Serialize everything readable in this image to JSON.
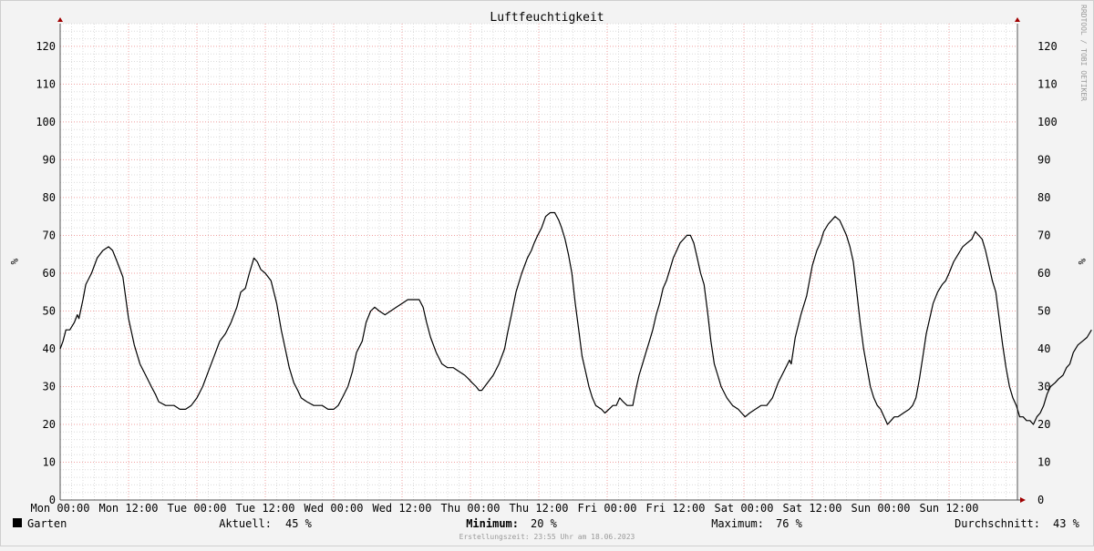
{
  "chart_data": {
    "type": "line",
    "title": "Luftfeuchtigkeit",
    "ylabel": "%",
    "ylim": [
      0,
      126
    ],
    "y_ticks": [
      0,
      10,
      20,
      30,
      40,
      50,
      60,
      70,
      80,
      90,
      100,
      110,
      120
    ],
    "x_range_hours": [
      0,
      168
    ],
    "x_ticks": [
      {
        "h": 0,
        "label": "Mon 00:00"
      },
      {
        "h": 12,
        "label": "Mon 12:00"
      },
      {
        "h": 24,
        "label": "Tue 00:00"
      },
      {
        "h": 36,
        "label": "Tue 12:00"
      },
      {
        "h": 48,
        "label": "Wed 00:00"
      },
      {
        "h": 60,
        "label": "Wed 12:00"
      },
      {
        "h": 72,
        "label": "Thu 00:00"
      },
      {
        "h": 84,
        "label": "Thu 12:00"
      },
      {
        "h": 96,
        "label": "Fri 00:00"
      },
      {
        "h": 108,
        "label": "Fri 12:00"
      },
      {
        "h": 120,
        "label": "Sat 00:00"
      },
      {
        "h": 132,
        "label": "Sat 12:00"
      },
      {
        "h": 144,
        "label": "Sun 00:00"
      },
      {
        "h": 156,
        "label": "Sun 12:00"
      }
    ],
    "grid": true,
    "series": [
      {
        "name": "Garten",
        "color": "#000000",
        "points": [
          [
            0,
            40
          ],
          [
            0.5,
            42
          ],
          [
            1,
            45
          ],
          [
            1.7,
            45
          ],
          [
            2.5,
            47
          ],
          [
            3,
            49
          ],
          [
            3.3,
            48
          ],
          [
            4,
            53
          ],
          [
            4.5,
            57
          ],
          [
            5.5,
            60
          ],
          [
            6.5,
            64
          ],
          [
            7.5,
            66
          ],
          [
            8.5,
            67
          ],
          [
            9.2,
            66
          ],
          [
            10,
            63
          ],
          [
            11,
            59
          ],
          [
            12,
            48
          ],
          [
            13,
            41
          ],
          [
            14,
            36
          ],
          [
            15,
            33
          ],
          [
            16,
            30
          ],
          [
            16.7,
            28
          ],
          [
            17.3,
            26
          ],
          [
            18.5,
            25
          ],
          [
            20,
            25
          ],
          [
            21,
            24
          ],
          [
            22,
            24
          ],
          [
            23,
            25
          ],
          [
            24,
            27
          ],
          [
            25,
            30
          ],
          [
            26,
            34
          ],
          [
            27,
            38
          ],
          [
            28,
            42
          ],
          [
            29,
            44
          ],
          [
            30,
            47
          ],
          [
            31,
            51
          ],
          [
            31.7,
            55
          ],
          [
            32.5,
            56
          ],
          [
            33.2,
            60
          ],
          [
            34,
            64
          ],
          [
            34.6,
            63
          ],
          [
            35.2,
            61
          ],
          [
            36,
            60
          ],
          [
            37,
            58
          ],
          [
            38,
            52
          ],
          [
            38.8,
            45
          ],
          [
            39.5,
            40
          ],
          [
            40.2,
            35
          ],
          [
            41,
            31
          ],
          [
            41.7,
            29
          ],
          [
            42.3,
            27
          ],
          [
            43.3,
            26
          ],
          [
            44.5,
            25
          ],
          [
            46,
            25
          ],
          [
            47,
            24
          ],
          [
            48,
            24
          ],
          [
            48.8,
            25
          ],
          [
            49.5,
            27
          ],
          [
            50.5,
            30
          ],
          [
            51.3,
            34
          ],
          [
            52,
            39
          ],
          [
            53,
            42
          ],
          [
            53.7,
            47
          ],
          [
            54.5,
            50
          ],
          [
            55.2,
            51
          ],
          [
            56,
            50
          ],
          [
            57,
            49
          ],
          [
            58,
            50
          ],
          [
            59,
            51
          ],
          [
            60,
            52
          ],
          [
            61,
            53
          ],
          [
            62,
            53
          ],
          [
            63,
            53
          ],
          [
            63.7,
            51
          ],
          [
            64.3,
            47
          ],
          [
            65,
            43
          ],
          [
            66,
            39
          ],
          [
            67,
            36
          ],
          [
            68,
            35
          ],
          [
            69,
            35
          ],
          [
            70,
            34
          ],
          [
            71,
            33
          ],
          [
            71.7,
            32
          ],
          [
            72.3,
            31
          ],
          [
            73,
            30
          ],
          [
            73.5,
            29
          ],
          [
            74,
            29
          ],
          [
            75,
            31
          ],
          [
            76,
            33
          ],
          [
            77,
            36
          ],
          [
            78,
            40
          ],
          [
            78.5,
            44
          ],
          [
            79.2,
            49
          ],
          [
            80,
            55
          ],
          [
            81,
            60
          ],
          [
            82,
            64
          ],
          [
            82.7,
            66
          ],
          [
            83.2,
            68
          ],
          [
            83.8,
            70
          ],
          [
            84.5,
            72
          ],
          [
            85.2,
            75
          ],
          [
            86,
            76
          ],
          [
            86.8,
            76
          ],
          [
            87.5,
            74
          ],
          [
            88,
            72
          ],
          [
            88.6,
            69
          ],
          [
            89.2,
            65
          ],
          [
            89.8,
            60
          ],
          [
            90.4,
            52
          ],
          [
            91,
            45
          ],
          [
            91.6,
            38
          ],
          [
            92.2,
            34
          ],
          [
            92.8,
            30
          ],
          [
            93.4,
            27
          ],
          [
            94,
            25
          ],
          [
            95,
            24
          ],
          [
            95.6,
            23
          ],
          [
            96.3,
            24
          ],
          [
            97,
            25
          ],
          [
            97.6,
            25
          ],
          [
            98.2,
            27
          ],
          [
            98.8,
            26
          ],
          [
            99.5,
            25
          ],
          [
            100.5,
            25
          ],
          [
            101,
            29
          ],
          [
            101.6,
            33
          ],
          [
            102.2,
            36
          ],
          [
            102.8,
            39
          ],
          [
            103.4,
            42
          ],
          [
            104,
            45
          ],
          [
            104.6,
            49
          ],
          [
            105.2,
            52
          ],
          [
            105.8,
            56
          ],
          [
            106.4,
            58
          ],
          [
            107,
            61
          ],
          [
            107.6,
            64
          ],
          [
            108.2,
            66
          ],
          [
            108.8,
            68
          ],
          [
            109.4,
            69
          ],
          [
            110,
            70
          ],
          [
            110.6,
            70
          ],
          [
            111.2,
            68
          ],
          [
            111.8,
            64
          ],
          [
            112.4,
            60
          ],
          [
            113,
            57
          ],
          [
            113.6,
            50
          ],
          [
            114.2,
            42
          ],
          [
            114.8,
            36
          ],
          [
            115.4,
            33
          ],
          [
            116,
            30
          ],
          [
            117,
            27
          ],
          [
            118,
            25
          ],
          [
            119,
            24
          ],
          [
            119.6,
            23
          ],
          [
            120.2,
            22
          ],
          [
            121,
            23
          ],
          [
            122,
            24
          ],
          [
            123,
            25
          ],
          [
            124,
            25
          ],
          [
            125,
            27
          ],
          [
            126,
            31
          ],
          [
            127,
            34
          ],
          [
            128,
            37
          ],
          [
            128.3,
            36
          ],
          [
            129,
            43
          ],
          [
            130,
            49
          ],
          [
            131,
            54
          ],
          [
            131.5,
            58
          ],
          [
            132,
            62
          ],
          [
            132.8,
            66
          ],
          [
            133.4,
            68
          ],
          [
            134,
            71
          ],
          [
            134.8,
            73
          ],
          [
            135.4,
            74
          ],
          [
            136,
            75
          ],
          [
            136.8,
            74
          ],
          [
            137.4,
            72
          ],
          [
            138,
            70
          ],
          [
            138.6,
            67
          ],
          [
            139.2,
            63
          ],
          [
            139.8,
            55
          ],
          [
            140.4,
            47
          ],
          [
            141,
            40
          ],
          [
            141.6,
            35
          ],
          [
            142.2,
            30
          ],
          [
            142.8,
            27
          ],
          [
            143.4,
            25
          ],
          [
            144,
            24
          ],
          [
            144.6,
            22
          ],
          [
            145.2,
            20
          ],
          [
            145.8,
            21
          ],
          [
            146.4,
            22
          ],
          [
            147,
            22
          ],
          [
            148,
            23
          ],
          [
            149,
            24
          ],
          [
            149.6,
            25
          ],
          [
            150.2,
            27
          ],
          [
            150.8,
            32
          ],
          [
            151.4,
            38
          ],
          [
            152,
            44
          ],
          [
            152.6,
            48
          ],
          [
            153.2,
            52
          ],
          [
            154,
            55
          ],
          [
            154.8,
            57
          ],
          [
            155.4,
            58
          ],
          [
            156,
            60
          ],
          [
            156.8,
            63
          ],
          [
            157.6,
            65
          ],
          [
            158.4,
            67
          ],
          [
            159.2,
            68
          ],
          [
            160,
            69
          ],
          [
            160.6,
            71
          ],
          [
            161.2,
            70
          ],
          [
            161.8,
            69
          ],
          [
            162.4,
            66
          ],
          [
            163,
            62
          ],
          [
            163.6,
            58
          ],
          [
            164.2,
            55
          ],
          [
            164.8,
            48
          ],
          [
            165.4,
            41
          ],
          [
            166,
            35
          ],
          [
            166.6,
            30
          ],
          [
            167.2,
            27
          ],
          [
            167.8,
            25
          ],
          [
            168.4,
            22
          ],
          [
            169,
            22
          ],
          [
            169.6,
            21
          ],
          [
            170.2,
            21
          ],
          [
            170.8,
            20
          ],
          [
            171.4,
            22
          ],
          [
            172,
            23
          ],
          [
            172.6,
            25
          ],
          [
            173.2,
            28
          ],
          [
            173.8,
            30
          ],
          [
            174.6,
            31
          ],
          [
            175.2,
            32
          ],
          [
            176,
            33
          ],
          [
            176.6,
            35
          ],
          [
            177.2,
            36
          ],
          [
            177.8,
            39
          ],
          [
            178.6,
            41
          ],
          [
            179.4,
            42
          ],
          [
            180.2,
            43
          ],
          [
            181,
            45
          ]
        ]
      }
    ]
  },
  "footer": {
    "legend_name": "Garten",
    "aktuell_label": "Aktuell:",
    "aktuell_value": "45 %",
    "minimum_label": "Minimum:",
    "minimum_value": "20 %",
    "maximum_label": "Maximum:",
    "maximum_value": "76 %",
    "durchschnitt_label": "Durchschnitt:",
    "durchschnitt_value": "43 %",
    "created": "Erstellungszeit: 23:55 Uhr am 18.06.2023"
  },
  "watermark": "RRDTOOL / TOBI OETIKER"
}
